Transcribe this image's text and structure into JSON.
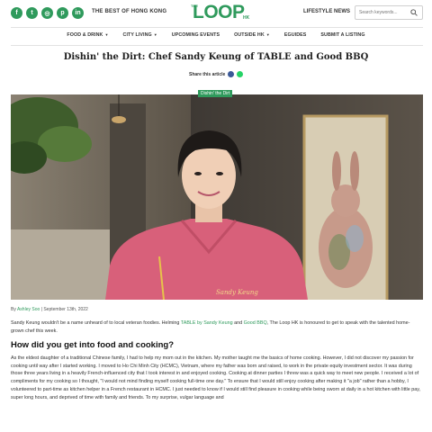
{
  "header": {
    "social": [
      {
        "icon": "facebook-icon",
        "glyph": "f"
      },
      {
        "icon": "twitter-icon",
        "glyph": "t"
      },
      {
        "icon": "instagram-icon",
        "glyph": "◎"
      },
      {
        "icon": "pinterest-icon",
        "glyph": "p"
      },
      {
        "icon": "linkedin-icon",
        "glyph": "in"
      }
    ],
    "tagline": "THE BEST OF HONG KONG",
    "logo": {
      "the": "THE",
      "loop": "LOOP",
      "hk": "HK"
    },
    "lifestyle": "LIFESTYLE NEWS",
    "search_placeholder": "Search keywords..."
  },
  "nav": [
    {
      "label": "FOOD & DRINK",
      "dropdown": true
    },
    {
      "label": "CITY LIVING",
      "dropdown": true
    },
    {
      "label": "UPCOMING EVENTS",
      "dropdown": false
    },
    {
      "label": "OUTSIDE HK",
      "dropdown": true
    },
    {
      "label": "EGUIDES",
      "dropdown": false
    },
    {
      "label": "SUBMIT A LISTING",
      "dropdown": false
    }
  ],
  "article": {
    "title": "Dishin' the Dirt: Chef Sandy Keung of TABLE and Good BBQ",
    "share_label": "Share this article",
    "category": "Dishin' the Dirt",
    "byline_prefix": "By",
    "author": "Ashley Soo",
    "date": "| September 13th, 2022",
    "intro_part1": "Sandy Keung wouldn't be a name unheard of to local veteran foodies. Helming ",
    "intro_link1": "TABLE by Sandy Keung",
    "intro_part2": " and ",
    "intro_link2": "Good BBQ",
    "intro_part3": ", The Loop HK is honoured to get to speak with the talented home-grown chef this week.",
    "question": "How did you get into food and cooking?",
    "answer": "As the eldest daughter of a traditional Chinese family, I had to help my mom out in the kitchen. My mother taught me the basics of home cooking. However, I did not discover my passion for cooking until way after I started working. I moved to Ho Chi Minh City (HCMC), Vietnam, where my father was born and raised, to work in the private equity investment sector. It was during those three years living in a heavily French-influenced city that I took interest in and enjoyed cooking. Cooking at dinner parties I threw was a quick way to meet new people. I received a lot of compliments for my cooking so I thought, \"I would not mind finding myself cooking full-time one day.\" To ensure that I would still enjoy cooking after making it \"a job\" rather than a hobby, I volunteered to part-time as kitchen helper in a French restaurant in HCMC. I just needed to know if I would still find pleasure in cooking while being sworn at daily in a hot kitchen with little pay, super long hours, and deprived of time with family and friends. To my surprise, vulgar language and"
  },
  "hero_image": {
    "apron_text": "Sandy Keung"
  },
  "colors": {
    "brand": "#2f9a5c"
  }
}
